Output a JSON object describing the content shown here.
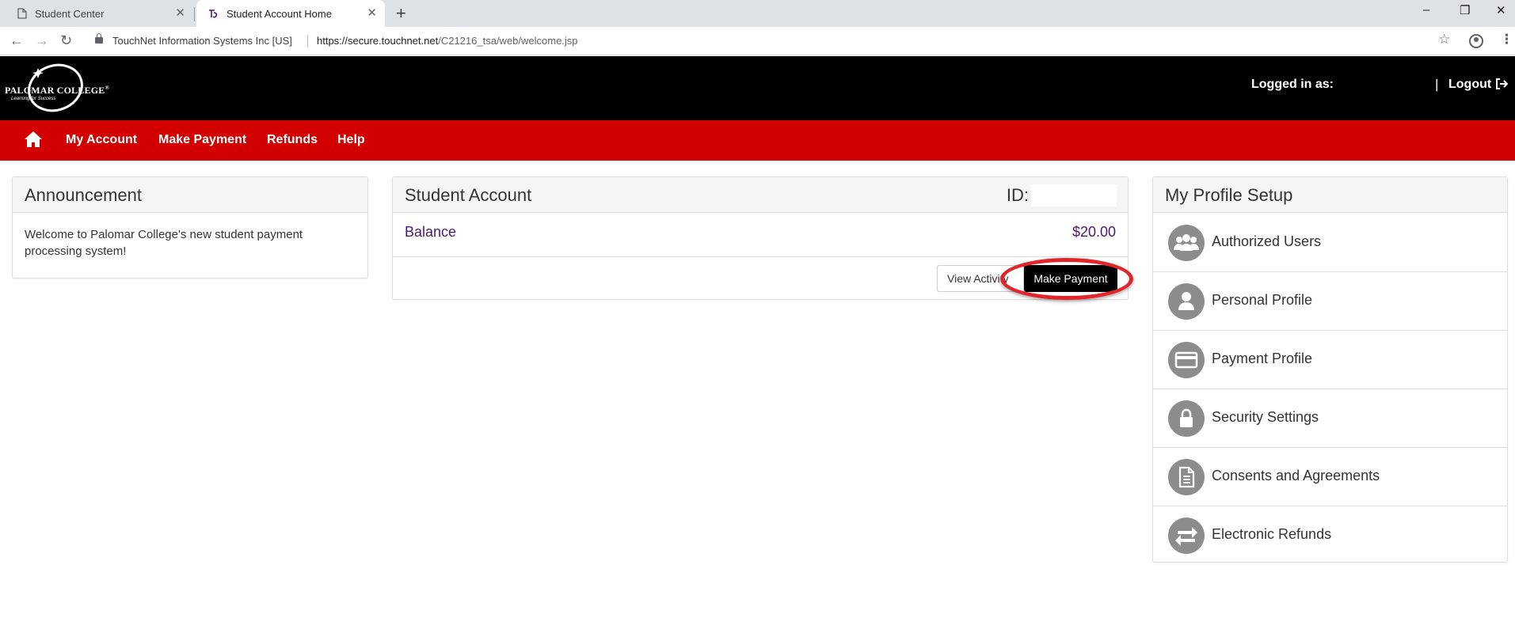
{
  "browser": {
    "tabs": [
      {
        "title": "Student Center",
        "active": false
      },
      {
        "title": "Student Account Home",
        "active": true
      }
    ],
    "new_tab_symbol": "+",
    "close_symbol": "✕",
    "window_controls": {
      "minimize": "–",
      "restore": "❐",
      "close": "✕"
    },
    "nav": {
      "back": "←",
      "forward": "→",
      "reload": "↻"
    },
    "cert_label": "TouchNet Information Systems Inc [US]",
    "url_host": "https://secure.touchnet.net",
    "url_path": "/C21216_tsa/web/welcome.jsp",
    "star": "☆",
    "menu": "⋮"
  },
  "header": {
    "logo_text": "PALOMAR COLLEGE",
    "logo_reg": "®",
    "logo_tagline": "Learning for Success",
    "logged_in_label": "Logged in as:",
    "separator": "|",
    "logout_label": "Logout",
    "logout_icon": "sign-out-icon"
  },
  "nav": {
    "home_icon": "home-icon",
    "items": [
      "My Account",
      "Make Payment",
      "Refunds",
      "Help"
    ]
  },
  "announcement": {
    "title": "Announcement",
    "body": "Welcome to Palomar College's new student payment processing system!"
  },
  "account": {
    "title": "Student Account",
    "id_label": "ID:",
    "balance_label": "Balance",
    "balance_value": "$20.00",
    "view_activity_label": "View Activity",
    "make_payment_label": "Make Payment"
  },
  "profile": {
    "title": "My Profile Setup",
    "items": [
      {
        "label": "Authorized Users",
        "icon": "users-icon"
      },
      {
        "label": "Personal Profile",
        "icon": "user-icon"
      },
      {
        "label": "Payment Profile",
        "icon": "credit-card-icon"
      },
      {
        "label": "Security Settings",
        "icon": "lock-icon"
      },
      {
        "label": "Consents and Agreements",
        "icon": "document-icon"
      },
      {
        "label": "Electronic Refunds",
        "icon": "refund-icon"
      }
    ]
  },
  "colors": {
    "header_bg": "#000000",
    "nav_bg": "#d20000",
    "link_purple": "#4b1a6e",
    "icon_gray": "#8c8c8c",
    "highlight_red": "#e0262b"
  }
}
